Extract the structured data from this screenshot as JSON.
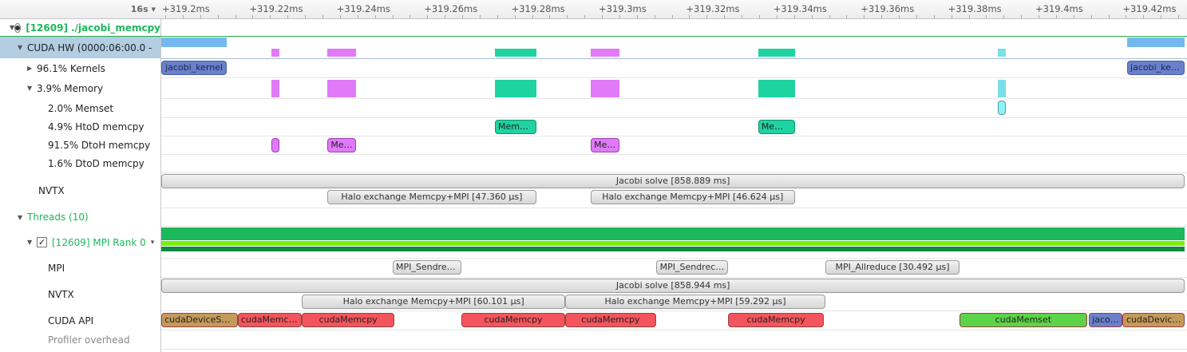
{
  "header": {
    "zoom_label": "16s",
    "ticks": [
      "+319.2ms",
      "+319.22ms",
      "+319.24ms",
      "+319.26ms",
      "+319.28ms",
      "+319.3ms",
      "+319.32ms",
      "+319.34ms",
      "+319.36ms",
      "+319.38ms",
      "+319.4ms",
      "+319.42ms"
    ],
    "tick_values_ms": [
      319.2,
      319.22,
      319.24,
      319.26,
      319.28,
      319.3,
      319.32,
      319.34,
      319.36,
      319.38,
      319.4,
      319.42
    ]
  },
  "tree": {
    "process": "[12609] ./jacobi_memcpy",
    "cuda_hw": "CUDA HW (0000:06:00.0 - ",
    "kernels": "96.1% Kernels",
    "memory": "3.9% Memory",
    "memset": "2.0% Memset",
    "htod": "4.9% HtoD memcpy",
    "dtoh": "91.5% DtoH memcpy",
    "dtod": "1.6% DtoD memcpy",
    "nvtx_gpu": "NVTX",
    "threads": "Threads (10)",
    "rank": "[12609] MPI Rank 0",
    "mpi": "MPI",
    "nvtx": "NVTX",
    "cuda_api": "CUDA API",
    "profiler": "Profiler overhead"
  },
  "colors": {
    "kernel": "#6a80cc",
    "dtoh": "#e07af8",
    "htod": "#1fd3a0",
    "memset": "#8ef2f8",
    "green": "#1db85a",
    "lime": "#7cf000"
  },
  "events": {
    "kernels": [
      {
        "label": "jacobi_kernel",
        "start": 319.1991,
        "end": 319.2141
      },
      {
        "label": "jacobi_ker…",
        "start": 319.4203,
        "end": 319.4335
      }
    ],
    "memset": [
      {
        "label": "",
        "start": 319.3907,
        "end": 319.3925
      }
    ],
    "htod": [
      {
        "label": "Memc…",
        "start": 319.2755,
        "end": 319.285
      },
      {
        "label": "Mem…",
        "start": 319.3358,
        "end": 319.3442
      }
    ],
    "dtoh": [
      {
        "label": "",
        "start": 319.2243,
        "end": 319.2261
      },
      {
        "label": "Me…",
        "start": 319.2371,
        "end": 319.2437
      },
      {
        "label": "Me…",
        "start": 319.2974,
        "end": 319.304
      }
    ],
    "nvtx_gpu_top": [
      {
        "label": "Jacobi solve [858.889 ms]",
        "start": 319.1991,
        "end": 319.4335
      }
    ],
    "nvtx_gpu_bot": [
      {
        "label": "Halo exchange Memcpy+MPI [47.360 µs]",
        "start": 319.2371,
        "end": 319.285
      },
      {
        "label": "Halo exchange Memcpy+MPI [46.624 µs]",
        "start": 319.2974,
        "end": 319.3442
      }
    ],
    "mpi": [
      {
        "label": "MPI_Sendrec…",
        "start": 319.2521,
        "end": 319.2678
      },
      {
        "label": "MPI_Sendrec…",
        "start": 319.3124,
        "end": 319.3289
      },
      {
        "label": "MPI_Allreduce [30.492 µs]",
        "start": 319.3512,
        "end": 319.3819
      }
    ],
    "nvtx_top": [
      {
        "label": "Jacobi solve [858.944 ms]",
        "start": 319.1991,
        "end": 319.4335
      }
    ],
    "nvtx_bot": [
      {
        "label": "Halo exchange Memcpy+MPI [60.101 µs]",
        "start": 319.2313,
        "end": 319.2916
      },
      {
        "label": "Halo exchange Memcpy+MPI [59.292 µs]",
        "start": 319.2916,
        "end": 319.3512
      }
    ],
    "cuda_api": [
      {
        "label": "cudaDeviceSy…",
        "start": 319.1991,
        "end": 319.2166,
        "color": "#c49a5a"
      },
      {
        "label": "cudaMemcpy",
        "start": 319.2166,
        "end": 319.2313,
        "color": "#f4545c"
      },
      {
        "label": "cudaMemcpy",
        "start": 319.2313,
        "end": 319.2525,
        "color": "#f4545c"
      },
      {
        "label": "cudaMemcpy",
        "start": 319.2678,
        "end": 319.2916,
        "color": "#f4545c"
      },
      {
        "label": "cudaMemcpy",
        "start": 319.2916,
        "end": 319.3124,
        "color": "#f4545c"
      },
      {
        "label": "cudaMemcpy",
        "start": 319.3289,
        "end": 319.3508,
        "color": "#f4545c"
      },
      {
        "label": "cudaMemset",
        "start": 319.3819,
        "end": 319.4111,
        "color": "#5cd448"
      },
      {
        "label": "jaco…",
        "start": 319.4115,
        "end": 319.4192,
        "color": "#6a80cc"
      },
      {
        "label": "cudaDevic…",
        "start": 319.4192,
        "end": 319.4335,
        "color": "#c49a5a"
      }
    ]
  }
}
